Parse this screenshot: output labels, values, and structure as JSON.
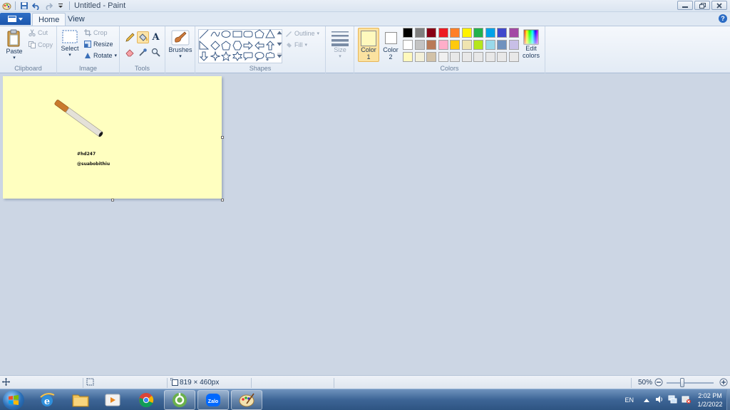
{
  "window": {
    "title": "Untitled - Paint"
  },
  "tabs": {
    "home": "Home",
    "view": "View"
  },
  "clipboard": {
    "paste": "Paste",
    "cut": "Cut",
    "copy": "Copy",
    "label": "Clipboard"
  },
  "image": {
    "select": "Select",
    "crop": "Crop",
    "resize": "Resize",
    "rotate": "Rotate",
    "label": "Image"
  },
  "tools": {
    "label": "Tools"
  },
  "brushes": {
    "label": "Brushes"
  },
  "shapes": {
    "outline": "Outline",
    "fill": "Fill",
    "label": "Shapes"
  },
  "size": {
    "label": "Size"
  },
  "colors": {
    "color1_label": "Color",
    "color1_num": "1",
    "color2_label": "Color",
    "color2_num": "2",
    "edit_label": "Edit",
    "edit_label2": "colors",
    "label": "Colors",
    "color1": "#fff9bd",
    "color2": "#ffffff",
    "palette_row1": [
      "#000000",
      "#7f7f7f",
      "#880015",
      "#ed1c24",
      "#ff7f27",
      "#fff200",
      "#22b14c",
      "#00a2e8",
      "#3f48cc",
      "#a349a4"
    ],
    "palette_row2": [
      "#ffffff",
      "#c3c3c3",
      "#b97a57",
      "#ffaec9",
      "#ffc90e",
      "#efe4b0",
      "#b5e61d",
      "#99d9ea",
      "#7092be",
      "#c8bfe7"
    ],
    "palette_row3": [
      "#fff9bd",
      "#f3f0d8",
      "#d2c2a8",
      "#f0f0f0",
      "#e8e8e8",
      "#e8e8e8",
      "#e8e8e8",
      "#e8e8e8",
      "#e8e8e8",
      "#e8e8e8"
    ]
  },
  "canvas": {
    "background": "#ffffc0",
    "text_line1": "#hd247",
    "text_line2": "@suabobithiu"
  },
  "status": {
    "dimensions": "819 × 460px",
    "zoom": "50%"
  },
  "taskbar": {
    "lang": "EN",
    "time": "2:02 PM",
    "date": "1/2/2022"
  }
}
